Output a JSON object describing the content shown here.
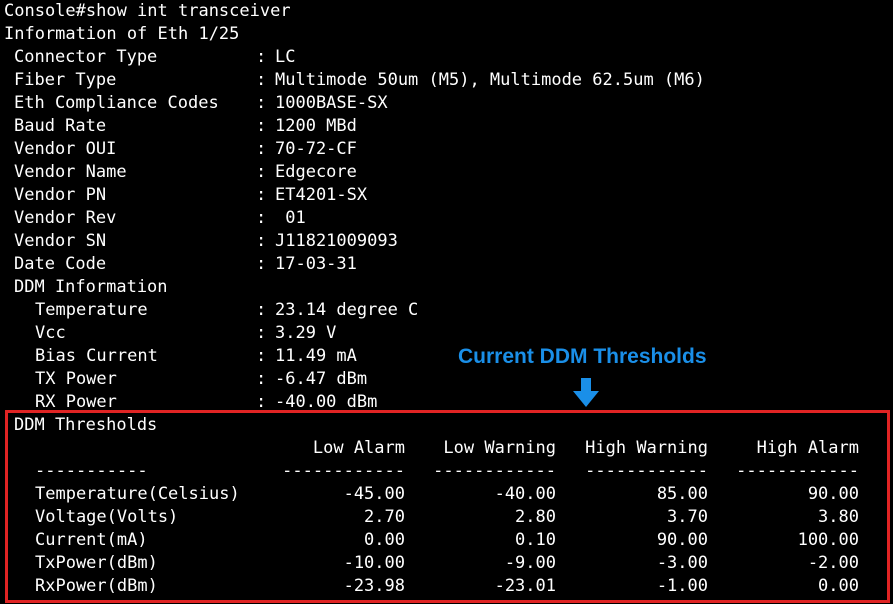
{
  "prompt_line": "Console#show int transceiver",
  "interface_header": "Information of Eth 1/25",
  "info": [
    {
      "label": "Connector Type",
      "value": "LC"
    },
    {
      "label": "Fiber Type",
      "value": "Multimode 50um (M5), Multimode 62.5um (M6)"
    },
    {
      "label": "Eth Compliance Codes",
      "value": "1000BASE-SX"
    },
    {
      "label": "Baud Rate",
      "value": "1200 MBd"
    },
    {
      "label": "Vendor OUI",
      "value": "70-72-CF"
    },
    {
      "label": "Vendor Name",
      "value": "Edgecore"
    },
    {
      "label": "Vendor PN",
      "value": "ET4201-SX"
    },
    {
      "label": "Vendor Rev",
      "value": " 01"
    },
    {
      "label": "Vendor SN",
      "value": "J11821009093"
    },
    {
      "label": "Date Code",
      "value": "17-03-31"
    }
  ],
  "ddm_info_header": "DDM Information",
  "ddm_info": [
    {
      "label": "Temperature",
      "value": "23.14 degree C"
    },
    {
      "label": "Vcc",
      "value": "3.29 V"
    },
    {
      "label": "Bias Current",
      "value": "11.49 mA"
    },
    {
      "label": "TX Power",
      "value": "-6.47 dBm"
    },
    {
      "label": "RX Power",
      "value": "-40.00 dBm"
    }
  ],
  "separator": ":",
  "annotation": "Current DDM Thresholds",
  "thresholds": {
    "header": "DDM Thresholds",
    "columns": [
      "Low Alarm",
      "Low Warning",
      "High Warning",
      "High Alarm"
    ],
    "label_rule": "-----------",
    "column_rule": "------------",
    "rows": [
      {
        "label": "Temperature(Celsius)",
        "values": [
          "-45.00",
          "-40.00",
          "85.00",
          "90.00"
        ]
      },
      {
        "label": "Voltage(Volts)",
        "values": [
          "2.70",
          "2.80",
          "3.70",
          "3.80"
        ]
      },
      {
        "label": "Current(mA)",
        "values": [
          "0.00",
          "0.10",
          "90.00",
          "100.00"
        ]
      },
      {
        "label": "TxPower(dBm)",
        "values": [
          "-10.00",
          "-9.00",
          "-3.00",
          "-2.00"
        ]
      },
      {
        "label": "RxPower(dBm)",
        "values": [
          "-23.98",
          "-23.01",
          "-1.00",
          "0.00"
        ]
      }
    ]
  },
  "colors": {
    "background": "#000000",
    "text": "#ffffff",
    "annotation": "#1a8fe8",
    "highlight_box": "#e02424"
  }
}
